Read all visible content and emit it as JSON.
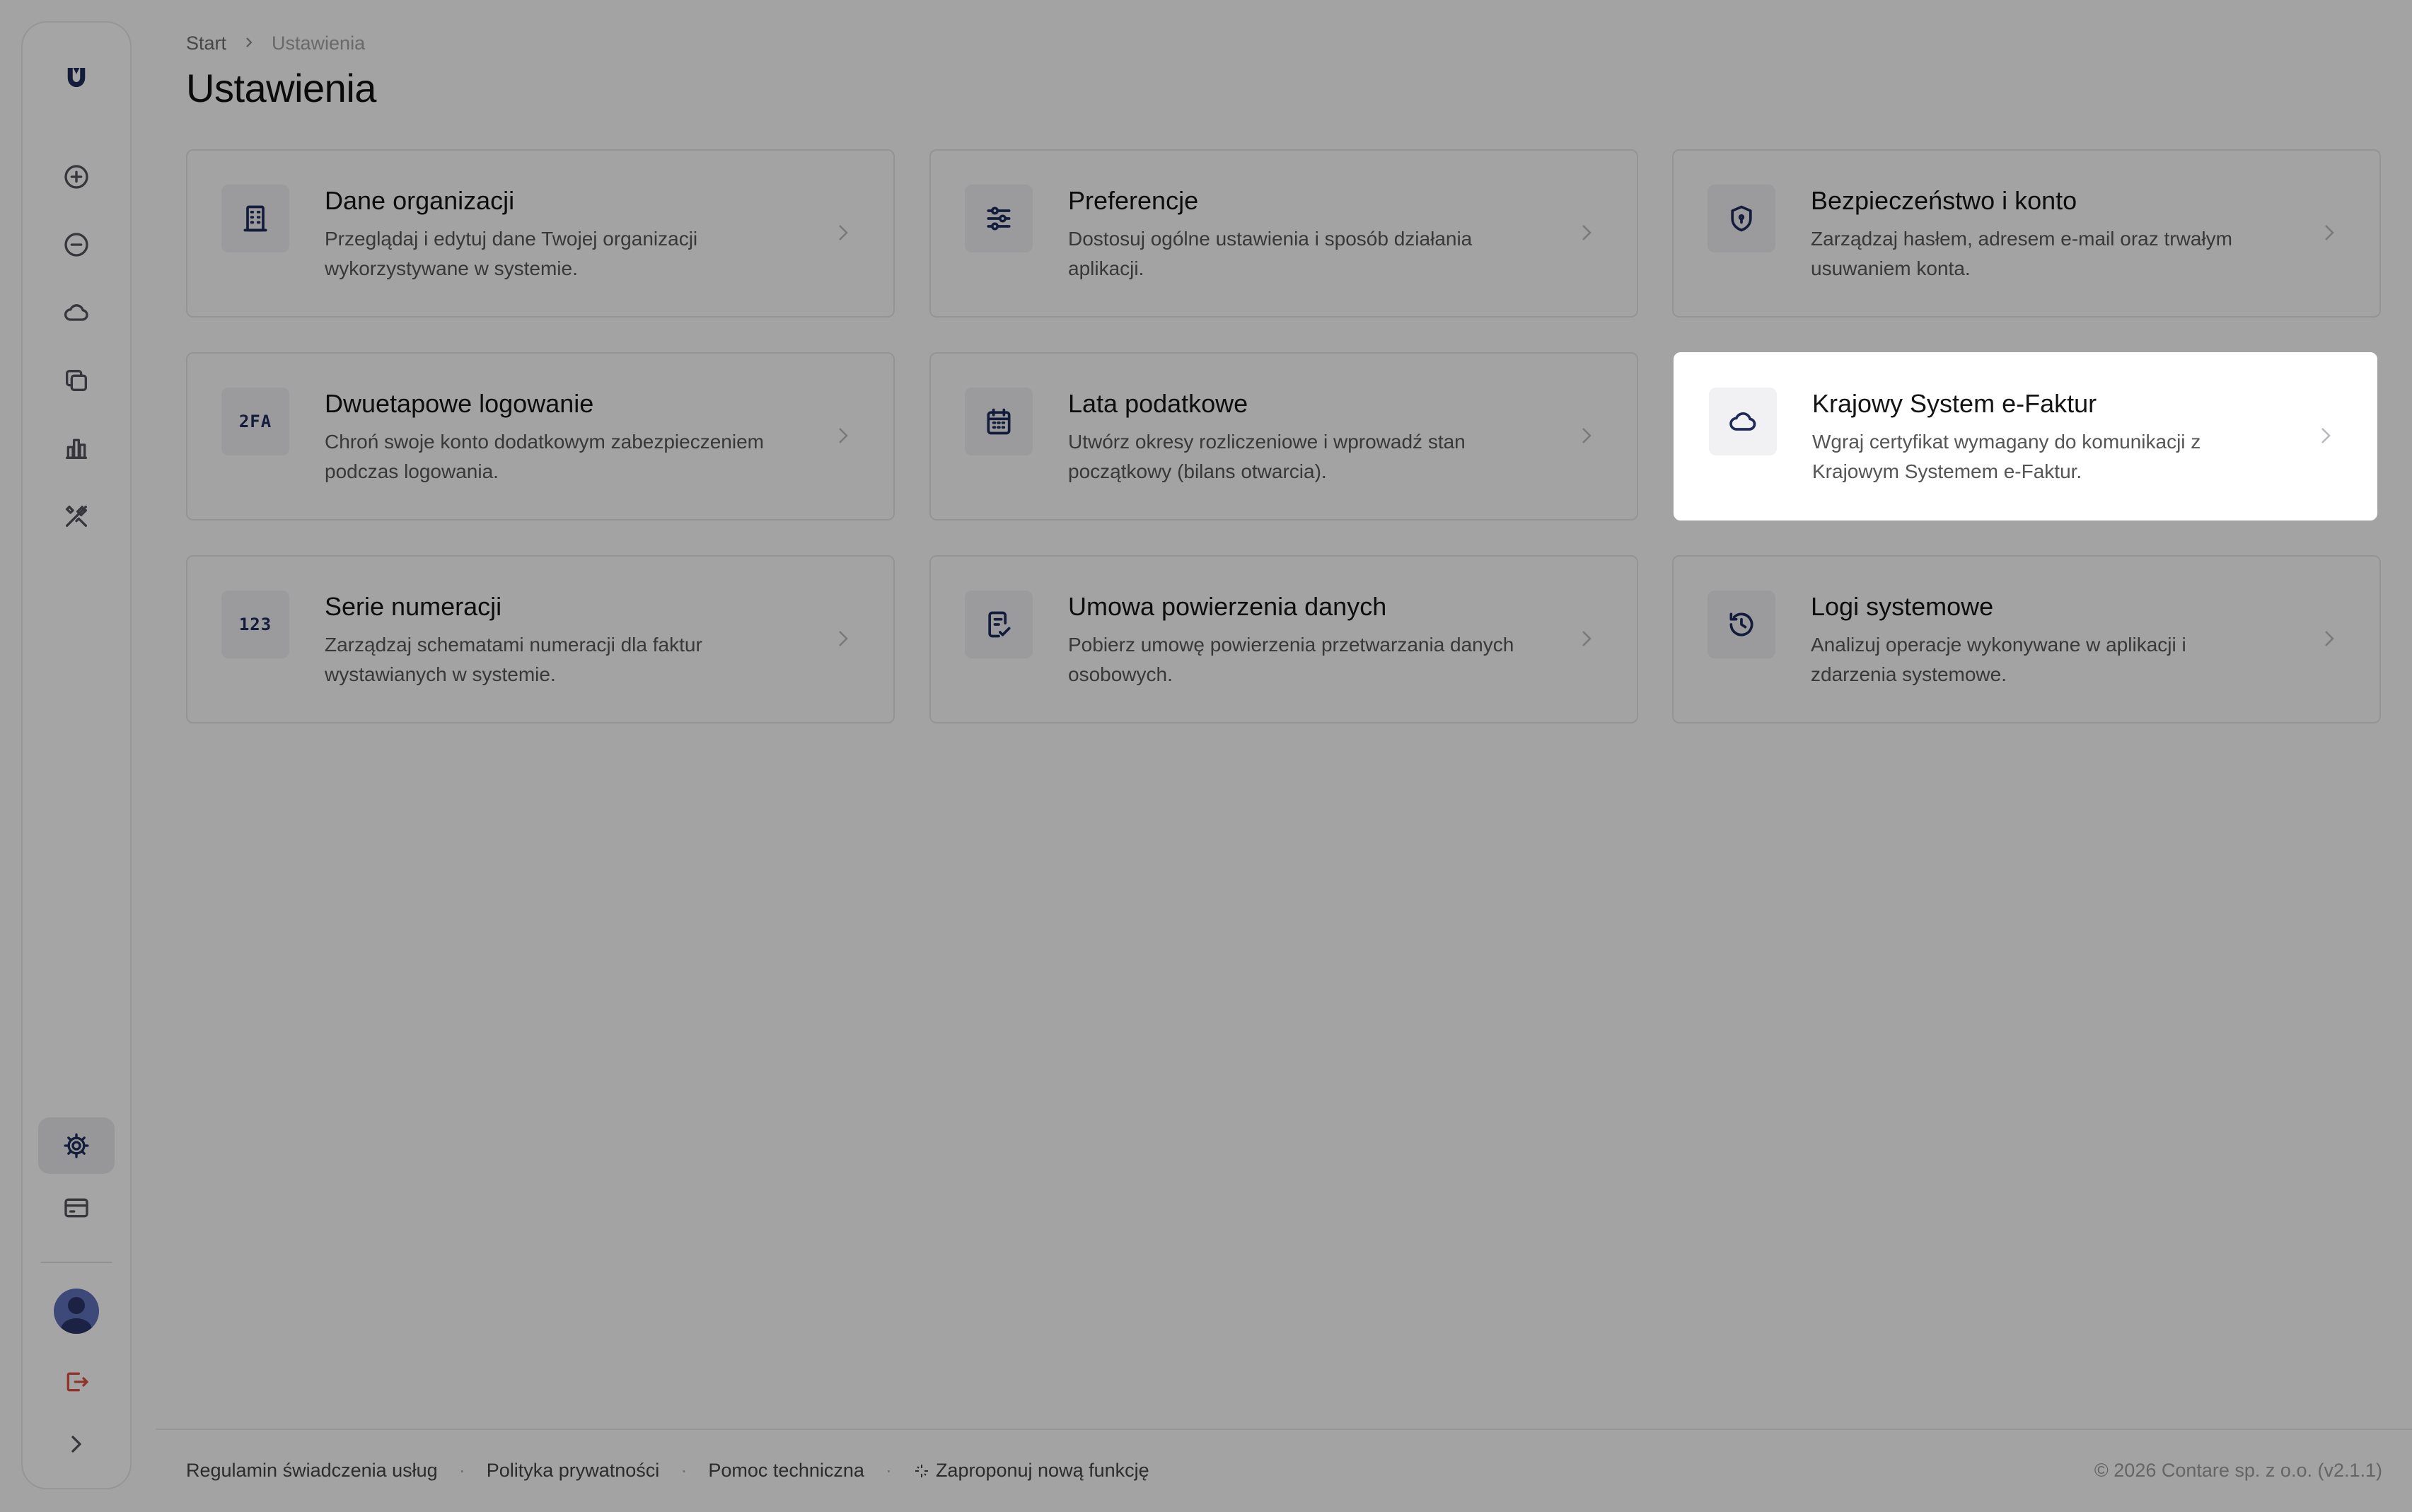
{
  "breadcrumb": {
    "root": "Start",
    "current": "Ustawienia"
  },
  "page": {
    "title": "Ustawienia"
  },
  "cards": [
    {
      "title": "Dane organizacji",
      "desc": "Przeglądaj i edytuj dane Twojej organizacji wykorzystywane w systemie.",
      "icon": "building-icon"
    },
    {
      "title": "Preferencje",
      "desc": "Dostosuj ogólne ustawienia i sposób działania aplikacji.",
      "icon": "sliders-icon"
    },
    {
      "title": "Bezpieczeństwo i konto",
      "desc": "Zarządzaj hasłem, adresem e-mail oraz trwałym usuwaniem konta.",
      "icon": "shield-icon"
    },
    {
      "title": "Dwuetapowe logowanie",
      "desc": "Chroń swoje konto dodatkowym zabezpieczeniem podczas logowania.",
      "icon": "2fa-icon",
      "icon_text": "2FA"
    },
    {
      "title": "Lata podatkowe",
      "desc": "Utwórz okresy rozliczeniowe i wprowadź stan początkowy (bilans otwarcia).",
      "icon": "calendar-icon"
    },
    {
      "title": "Krajowy System e-Faktur",
      "desc": "Wgraj certyfikat wymagany do komunikacji z Krajowym Systemem e-Faktur.",
      "icon": "cloud-icon",
      "highlighted": true
    },
    {
      "title": "Serie numeracji",
      "desc": "Zarządzaj schematami numeracji dla faktur wystawianych w systemie.",
      "icon": "123-icon",
      "icon_text": "123"
    },
    {
      "title": "Umowa powierzenia danych",
      "desc": "Pobierz umowę powierzenia przetwarzania danych osobowych.",
      "icon": "document-check-icon"
    },
    {
      "title": "Logi systemowe",
      "desc": "Analizuj operacje wykonywane w aplikacji i zdarzenia systemowe.",
      "icon": "history-icon"
    }
  ],
  "sidebar": {
    "items": [
      "logo-icon",
      "plus-circle-icon",
      "minus-circle-icon",
      "cloud-icon",
      "copy-icon",
      "chart-icon",
      "tools-icon",
      "gear-icon",
      "card-icon",
      "avatar",
      "logout-icon",
      "chevron-right-icon"
    ],
    "active": "gear-icon"
  },
  "footer": {
    "links": [
      "Regulamin świadczenia usług",
      "Polityka prywatności",
      "Pomoc techniczna",
      "Zaproponuj nową funkcję"
    ],
    "separator": "·",
    "copyright": "© 2026 Contare sp. z o.o. (v2.1.1)"
  },
  "colors": {
    "accent": "#1e2b58",
    "logout": "#d94f3d",
    "avatar": "#5b6fb8"
  }
}
